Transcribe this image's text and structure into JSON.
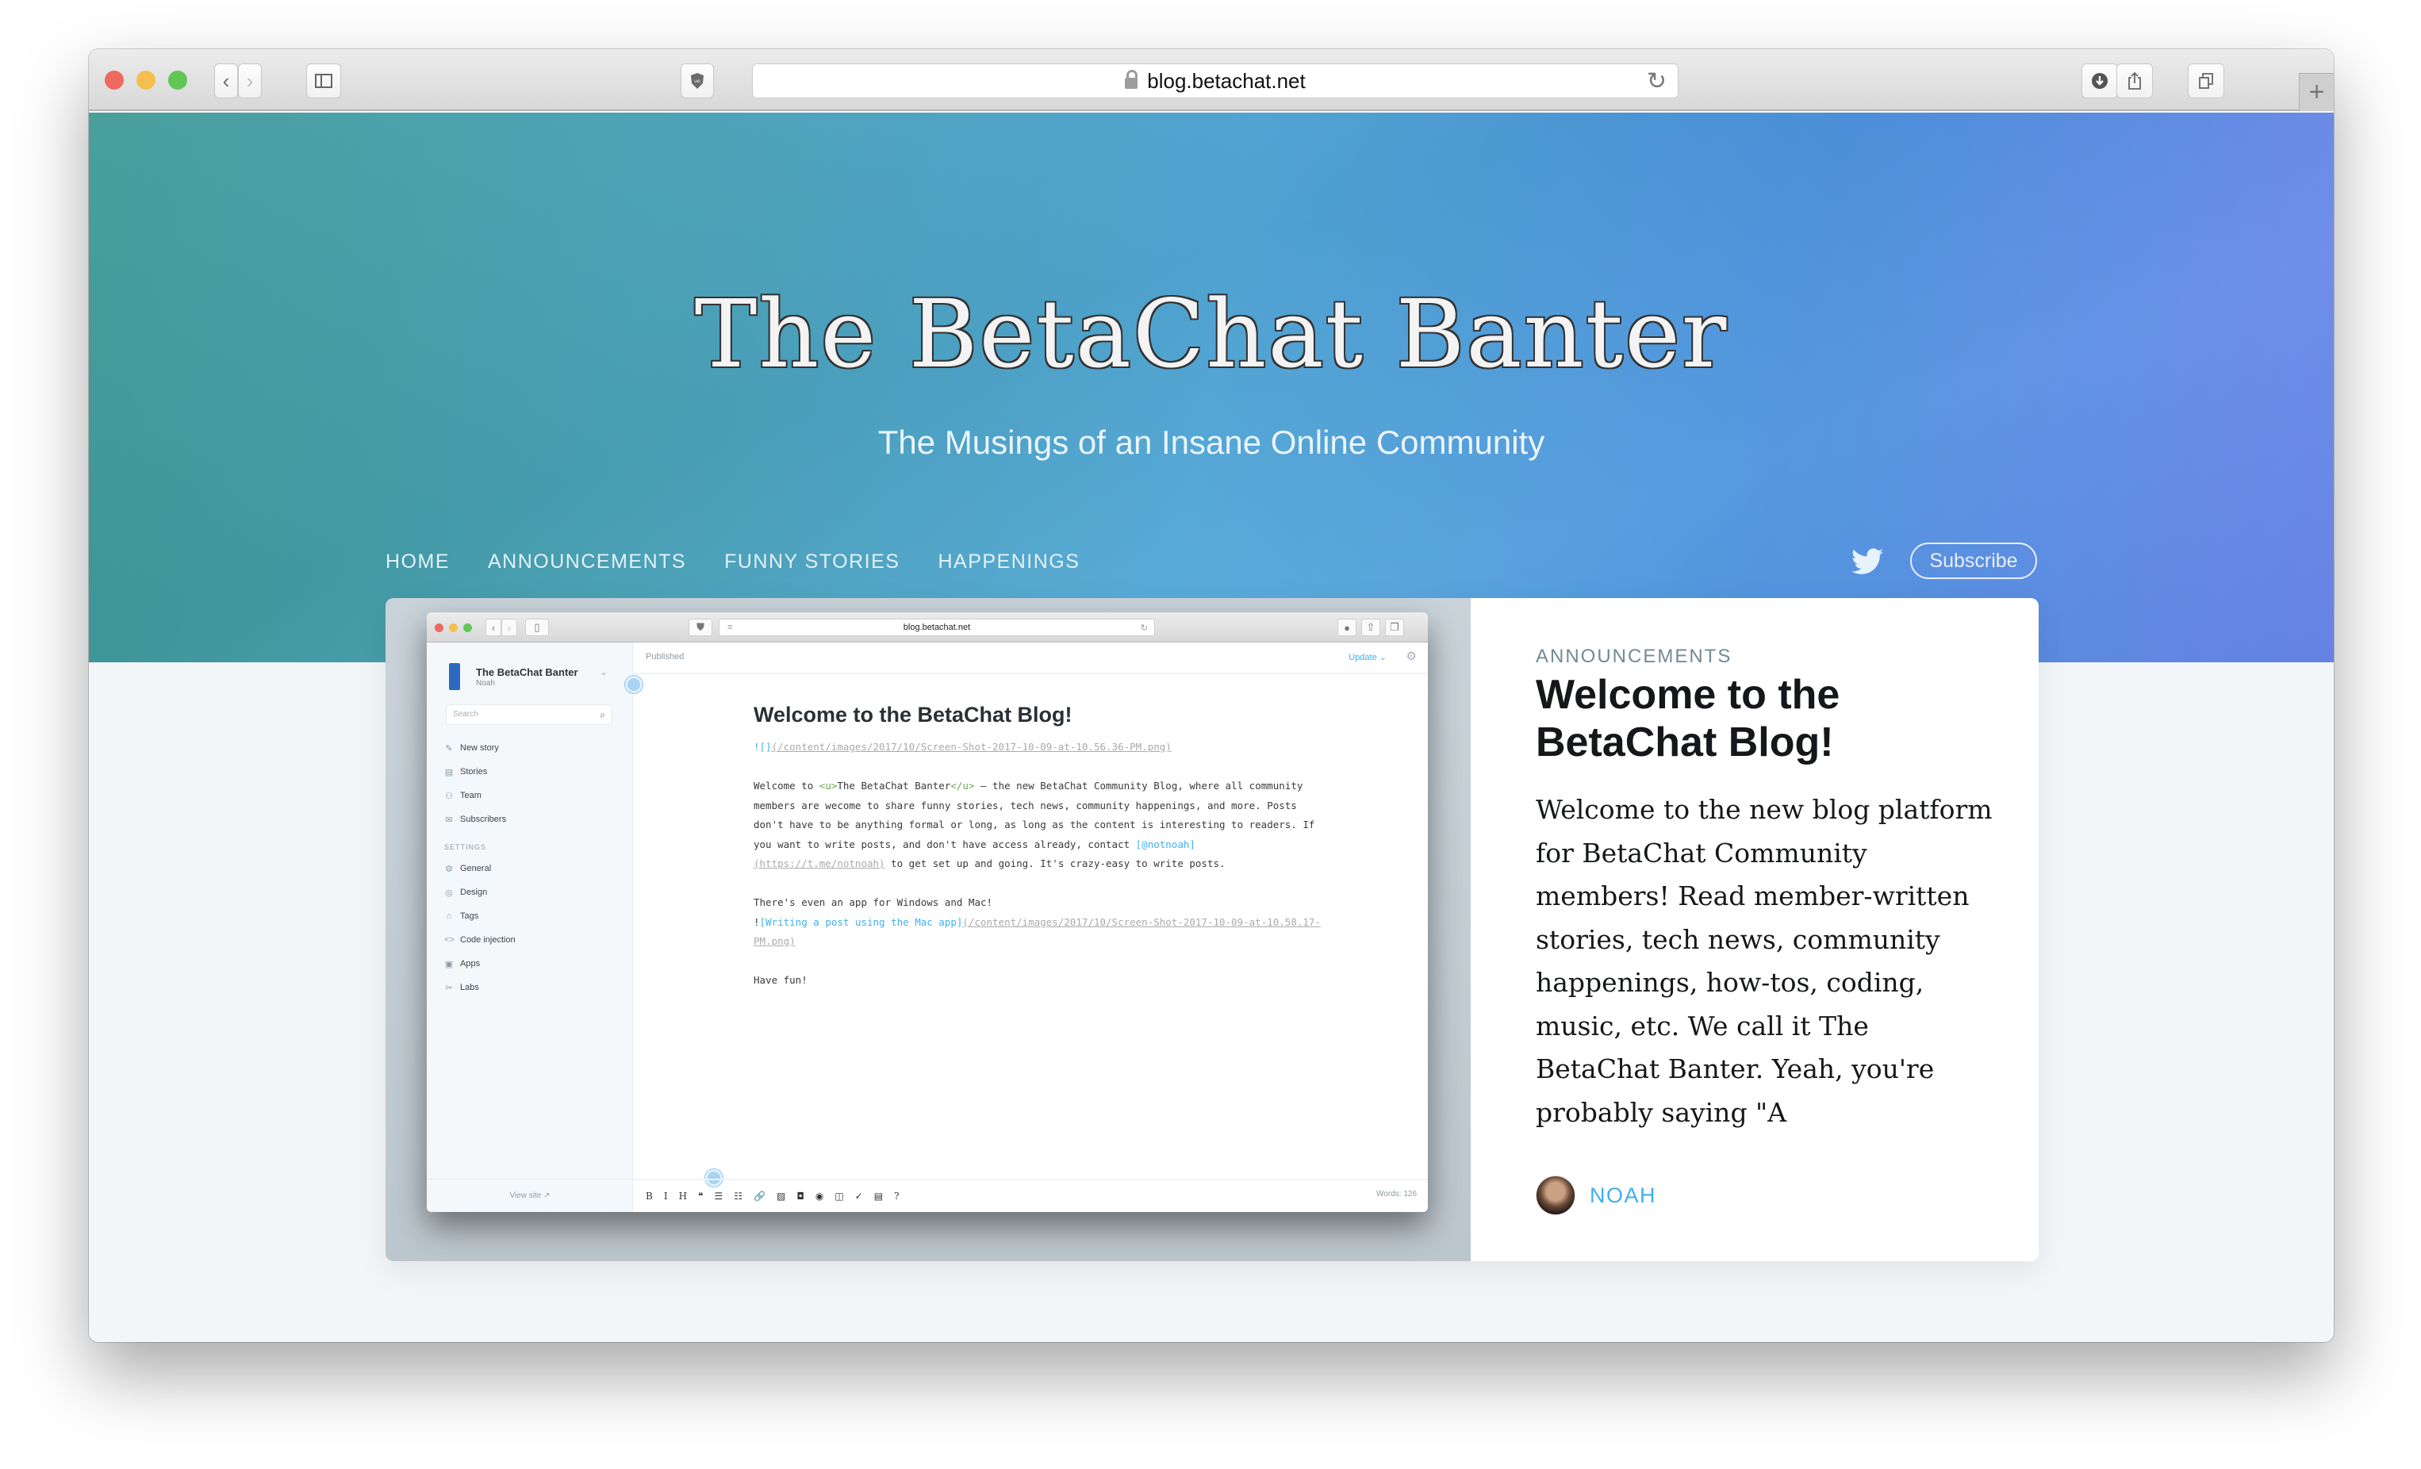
{
  "browser": {
    "url": "blog.betachat.net",
    "new_tab_label": "+"
  },
  "site": {
    "title": "The BetaChat Banter",
    "tagline": "The Musings of an Insane Online Community",
    "nav": [
      {
        "label": "HOME"
      },
      {
        "label": "ANNOUNCEMENTS"
      },
      {
        "label": "FUNNY STORIES"
      },
      {
        "label": "HAPPENINGS"
      }
    ],
    "subscribe_label": "Subscribe"
  },
  "featured_post": {
    "tag": "ANNOUNCEMENTS",
    "title": "Welcome to the BetaChat Blog!",
    "excerpt": "Welcome to the new blog platform for BetaChat Community members! Read member-written stories, tech news, community happenings, how-tos, coding, music, etc. We call it The BetaChat Banter. Yeah, you're probably saying \"A",
    "author": "NOAH",
    "image": {
      "url": "blog.betachat.net",
      "blog_name": "The BetaChat Banter",
      "user": "Noah",
      "search_placeholder": "Search",
      "menu": [
        {
          "icon": "pencil-icon",
          "glyph": "✎",
          "label": "New story"
        },
        {
          "icon": "document-icon",
          "glyph": "▤",
          "label": "Stories"
        },
        {
          "icon": "team-icon",
          "glyph": "⚇",
          "label": "Team"
        },
        {
          "icon": "mail-icon",
          "glyph": "✉",
          "label": "Subscribers"
        }
      ],
      "settings_heading": "SETTINGS",
      "settings": [
        {
          "icon": "gear-icon",
          "glyph": "⚙",
          "label": "General"
        },
        {
          "icon": "compass-icon",
          "glyph": "◎",
          "label": "Design"
        },
        {
          "icon": "tag-icon",
          "glyph": "⌂",
          "label": "Tags"
        },
        {
          "icon": "code-icon",
          "glyph": "<>",
          "label": "Code injection"
        },
        {
          "icon": "box-icon",
          "glyph": "▣",
          "label": "Apps"
        },
        {
          "icon": "tools-icon",
          "glyph": "✂",
          "label": "Labs"
        }
      ],
      "view_site": "View site",
      "status": "Published",
      "update_label": "Update ⌄",
      "editor_title": "Welcome to the BetaChat Blog!",
      "md": {
        "img1_prefix": "![]",
        "img1_url": "(/content/images/2017/10/Screen-Shot-2017-10-09-at-10.56.36-PM.png)",
        "p1_a": "Welcome to ",
        "p1_tag_open": "<u>",
        "p1_b": "The BetaChat Banter",
        "p1_tag_close": "</u>",
        "p1_c": " – the new BetaChat Community Blog, where all community members are wecome to share funny stories, tech news, community happenings, and more. Posts don't have to be anything formal or long, as long as the content is interesting to readers. If you want to write posts, and don't have access already, contact ",
        "p1_link": "[@notnoah]",
        "p1_link_url": "(https://t.me/notnoah)",
        "p1_d": " to get set up and going. It's crazy-easy to write posts.",
        "p2": "There's even an app for Windows and Mac!",
        "img2_prefix": "!",
        "img2_alt": "[Writing a post using the Mac app]",
        "img2_url": "(/content/images/2017/10/Screen-Shot-2017-10-09-at-10.58.17-PM.png)",
        "p3": "Have fun!"
      },
      "toolbar": [
        "B",
        "I",
        "H",
        "❝",
        "☰",
        "☷",
        "🔗",
        "▨",
        "◘",
        "◉",
        "◫",
        "✓",
        "▤",
        "?"
      ],
      "word_count": "Words: 126"
    }
  }
}
